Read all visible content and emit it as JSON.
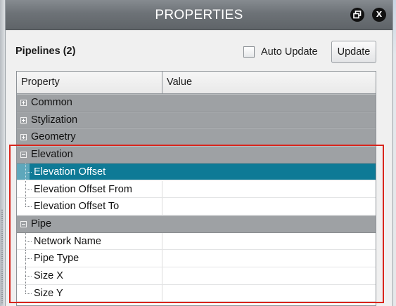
{
  "window": {
    "title": "PROPERTIES",
    "restore_icon": "restore-window-icon",
    "close_icon": "close-icon",
    "close_glyph": "X"
  },
  "header": {
    "selection_label": "Pipelines (2)",
    "auto_update_label": "Auto Update",
    "auto_update_checked": false,
    "update_button_label": "Update"
  },
  "grid": {
    "columns": {
      "property": "Property",
      "value": "Value"
    },
    "rows": [
      {
        "kind": "group",
        "label": "Common",
        "expanded": false
      },
      {
        "kind": "group",
        "label": "Stylization",
        "expanded": false
      },
      {
        "kind": "group",
        "label": "Geometry",
        "expanded": false
      },
      {
        "kind": "group",
        "label": "Elevation",
        "expanded": true
      },
      {
        "kind": "item",
        "label": "Elevation Offset",
        "value": "",
        "selected": true
      },
      {
        "kind": "item",
        "label": "Elevation Offset From",
        "value": ""
      },
      {
        "kind": "item",
        "label": "Elevation Offset To",
        "value": ""
      },
      {
        "kind": "group",
        "label": "Pipe",
        "expanded": true
      },
      {
        "kind": "item",
        "label": "Network Name",
        "value": ""
      },
      {
        "kind": "item",
        "label": "Pipe Type",
        "value": ""
      },
      {
        "kind": "item",
        "label": "Size X",
        "value": ""
      },
      {
        "kind": "item",
        "label": "Size Y",
        "value": ""
      }
    ]
  },
  "colors": {
    "title_bar": "#6d7277",
    "group_row": "#9ea1a4",
    "selected_row": "#0e7a96",
    "annotation": "#d9251c"
  }
}
